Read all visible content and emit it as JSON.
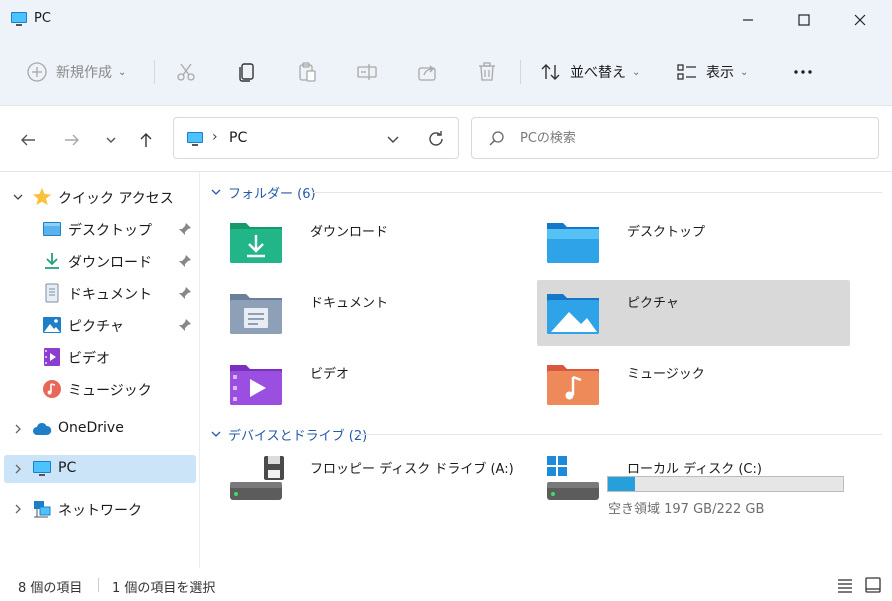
{
  "window": {
    "title": "PC"
  },
  "toolbar": {
    "new_label": "新規作成",
    "sort_label": "並べ替え",
    "view_label": "表示"
  },
  "address": {
    "location": "PC"
  },
  "search": {
    "placeholder": "PCの検索",
    "value": ""
  },
  "sidebar": {
    "quick_access": "クイック アクセス",
    "pinned": [
      {
        "label": "デスクトップ",
        "icon": "desktop-icon"
      },
      {
        "label": "ダウンロード",
        "icon": "download-icon"
      },
      {
        "label": "ドキュメント",
        "icon": "document-icon"
      },
      {
        "label": "ピクチャ",
        "icon": "picture-icon"
      },
      {
        "label": "ビデオ",
        "icon": "video-icon"
      },
      {
        "label": "ミュージック",
        "icon": "music-icon"
      }
    ],
    "onedrive": "OneDrive",
    "pc": "PC",
    "network": "ネットワーク"
  },
  "content": {
    "folders_header": "フォルダー (6)",
    "folders": [
      {
        "label": "ダウンロード"
      },
      {
        "label": "デスクトップ"
      },
      {
        "label": "ドキュメント"
      },
      {
        "label": "ピクチャ"
      },
      {
        "label": "ビデオ"
      },
      {
        "label": "ミュージック"
      }
    ],
    "devices_header": "デバイスとドライブ (2)",
    "drives": [
      {
        "label": "フロッピー ディスク ドライブ (A:)"
      },
      {
        "label": "ローカル ディスク (C:)",
        "free_text": "空き領域 197 GB/222 GB",
        "used_fraction": 0.113
      }
    ]
  },
  "status": {
    "item_count": "8 個の項目",
    "selected_count": "1 個の項目を選択"
  },
  "colors": {
    "accent": "#0067c0",
    "selection": "#cce4f7",
    "drive_fill": "#26a0da",
    "group_header": "#2459a8"
  }
}
